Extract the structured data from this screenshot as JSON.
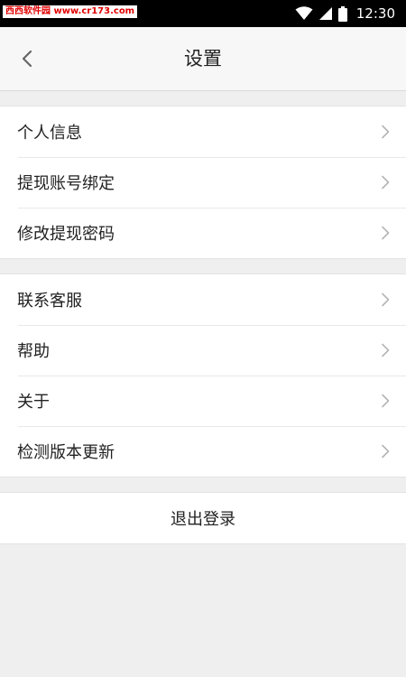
{
  "status_bar": {
    "watermark": "西西软件园 www.cr173.com",
    "time": "12:30",
    "icons": [
      "wifi-icon",
      "signal-icon",
      "battery-icon"
    ]
  },
  "nav": {
    "title": "设置",
    "back_icon": "chevron-left-icon"
  },
  "groups": [
    {
      "items": [
        {
          "label": "个人信息"
        },
        {
          "label": "提现账号绑定"
        },
        {
          "label": "修改提现密码"
        }
      ]
    },
    {
      "items": [
        {
          "label": "联系客服"
        },
        {
          "label": "帮助"
        },
        {
          "label": "关于"
        },
        {
          "label": "检测版本更新"
        }
      ]
    }
  ],
  "logout": {
    "label": "退出登录"
  },
  "colors": {
    "background": "#efefef",
    "surface": "#ffffff",
    "nav_bar": "#f7f7f7",
    "status_bar": "#000000",
    "watermark_text": "#e00000",
    "chevron": "#b5b5b5"
  }
}
